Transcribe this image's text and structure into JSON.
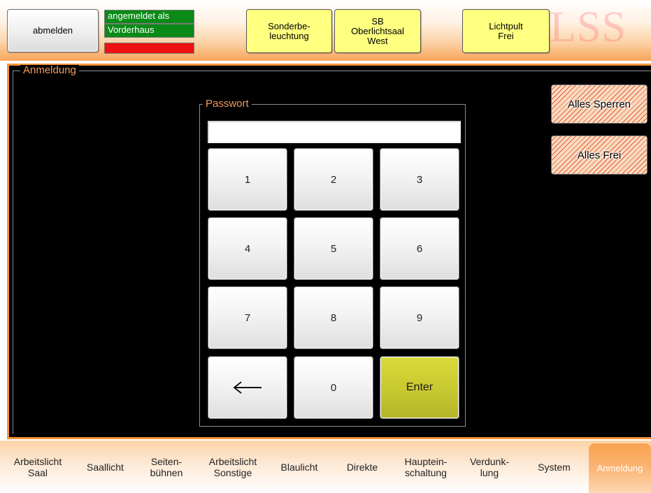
{
  "header": {
    "logout_label": "abmelden",
    "status_line1": "angemeldet als",
    "status_line2": "Vorderhaus",
    "buttons": [
      {
        "label": "Sonderbe-\nleuchtung"
      },
      {
        "label": "SB\nOberlichtsaal\nWest"
      },
      {
        "label": "Lichtpult\nFrei"
      }
    ],
    "logo_text": "LSS"
  },
  "panel": {
    "legend": "Anmeldung",
    "password": {
      "legend": "Passwort",
      "value": ""
    },
    "keys": [
      "1",
      "2",
      "3",
      "4",
      "5",
      "6",
      "7",
      "8",
      "9",
      "0"
    ],
    "enter_label": "Enter",
    "backspace_icon": "left-arrow-icon",
    "lock_all_label": "Alles Sperren",
    "free_all_label": "Alles Frei"
  },
  "tabs": [
    {
      "label": "Arbeitslicht\nSaal"
    },
    {
      "label": "Saallicht"
    },
    {
      "label": "Seiten-\nbühnen"
    },
    {
      "label": "Arbeitslicht\nSonstige"
    },
    {
      "label": "Blaulicht"
    },
    {
      "label": "Direkte"
    },
    {
      "label": "Hauptein-\nschaltung"
    },
    {
      "label": "Verdunk-\nlung"
    },
    {
      "label": "System"
    },
    {
      "label": "Anmeldung"
    }
  ],
  "active_tab": "Anmeldung",
  "colors": {
    "accent_orange": "#f7953a",
    "status_green": "#0a8a16",
    "status_red": "#ee1111",
    "yellow_button": "#ffff80",
    "enter_key": "#c8c830"
  }
}
